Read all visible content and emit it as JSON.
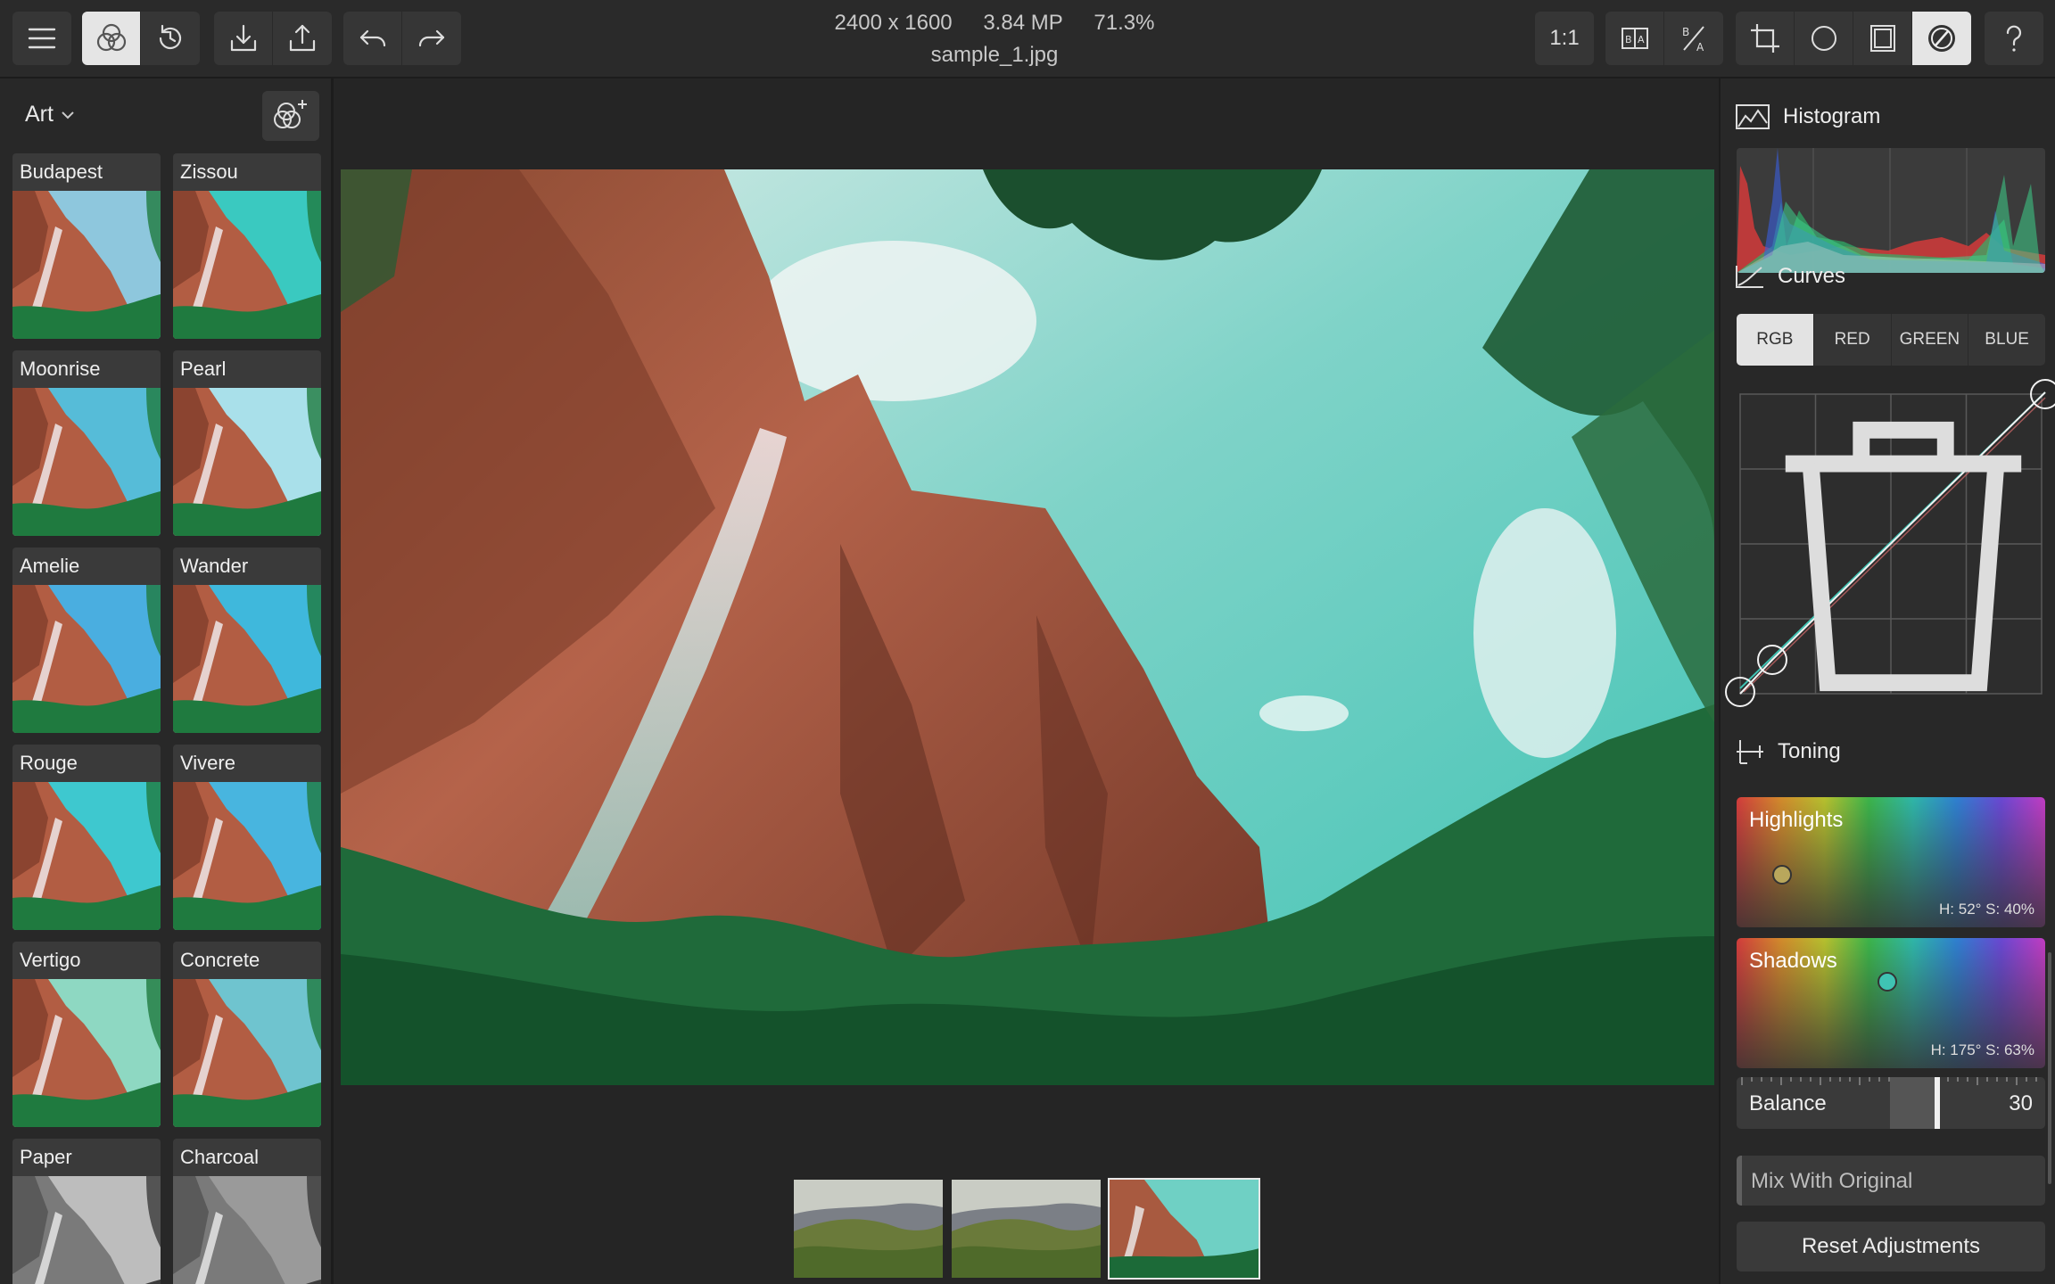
{
  "toolbar": {
    "left_icons": [
      "menu-icon",
      "filters-icon",
      "history-icon",
      "import-icon",
      "export-icon",
      "undo-icon",
      "redo-icon"
    ],
    "zoom_button": "1:1",
    "right_icons": [
      "before-after-icon",
      "compare-icon",
      "crop-icon",
      "vignette-icon",
      "frame-icon",
      "adjust-icon",
      "help-icon"
    ]
  },
  "document": {
    "dimensions": "2400 x 1600",
    "megapixels": "3.84 MP",
    "zoom": "71.3%",
    "filename": "sample_1.jpg"
  },
  "left_panel": {
    "category": "Art",
    "filters": [
      {
        "name": "Budapest",
        "tint": "#8ec7dd"
      },
      {
        "name": "Zissou",
        "tint": "#3ac9c0"
      },
      {
        "name": "Moonrise",
        "tint": "#56bcd8"
      },
      {
        "name": "Pearl",
        "tint": "#a9e0ea"
      },
      {
        "name": "Amelie",
        "tint": "#4aaee0"
      },
      {
        "name": "Wander",
        "tint": "#3fb8dc"
      },
      {
        "name": "Rouge",
        "tint": "#3ec8cf"
      },
      {
        "name": "Vivere",
        "tint": "#48b5df"
      },
      {
        "name": "Vertigo",
        "tint": "#8ed8c2"
      },
      {
        "name": "Concrete",
        "tint": "#6fc4cf"
      },
      {
        "name": "Paper",
        "tint": "#bdbdbd"
      },
      {
        "name": "Charcoal",
        "tint": "#9a9a9a"
      }
    ]
  },
  "filmstrip": [
    {
      "name": "mountain-valley-1",
      "selected": false
    },
    {
      "name": "mountain-valley-2",
      "selected": false
    },
    {
      "name": "cliff-waterfall",
      "selected": true
    }
  ],
  "right_panel": {
    "histogram_title": "Histogram",
    "curves_title": "Curves",
    "curve_tabs": [
      "RGB",
      "RED",
      "GREEN",
      "BLUE"
    ],
    "active_curve_tab": "RGB",
    "toning_title": "Toning",
    "highlights": {
      "label": "Highlights",
      "value": "H: 52° S: 40%",
      "color": "#b9a75c"
    },
    "shadows": {
      "label": "Shadows",
      "value": "H: 175° S: 63%",
      "color": "#3fc3b3"
    },
    "balance": {
      "label": "Balance",
      "value": "30"
    },
    "mix_label": "Mix With Original",
    "reset_label": "Reset Adjustments"
  }
}
